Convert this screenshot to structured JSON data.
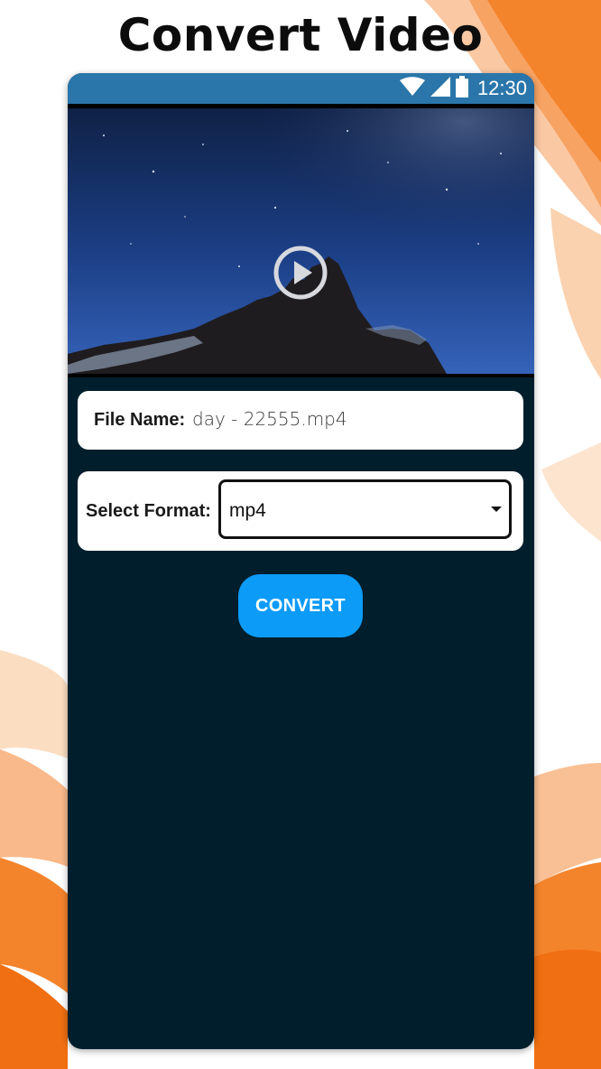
{
  "promo": {
    "title": "Convert Video"
  },
  "status_bar": {
    "time": "12:30",
    "icons": [
      "wifi-icon",
      "signal-icon",
      "battery-icon"
    ]
  },
  "video": {
    "thumbnail": "night-sky-mountain",
    "play_icon": "play-icon"
  },
  "file_info": {
    "label": "File Name:",
    "value": "day - 22555.mp4"
  },
  "format": {
    "label": "Select Format:",
    "selected": "mp4"
  },
  "actions": {
    "convert_label": "CONVERT"
  },
  "colors": {
    "screen_background": "#011e2c",
    "status_bar": "#2a76aa",
    "accent": "#0c9bf7",
    "decor_orange": "#f4842c"
  }
}
